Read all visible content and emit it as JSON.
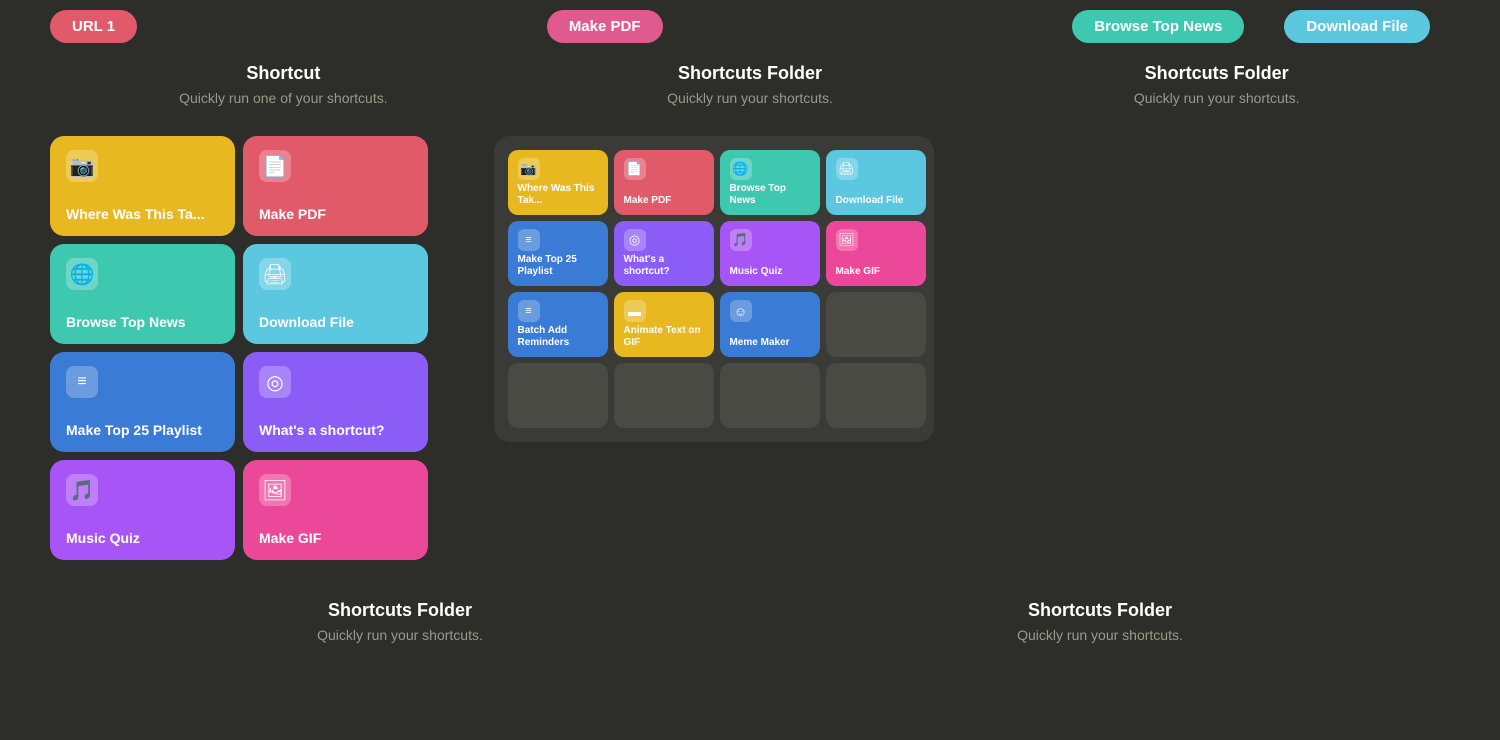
{
  "topPills": [
    {
      "label": "URL 1",
      "color": "pill-red"
    },
    {
      "label": "Make PDF",
      "color": "pill-pink"
    },
    {
      "label": "Browse Top News",
      "color": "pill-teal"
    },
    {
      "label": "Download File",
      "color": "pill-blue"
    }
  ],
  "sections": {
    "left": {
      "title": "Shortcut",
      "subtitle": "Quickly run one of your shortcuts."
    },
    "middle": {
      "title": "Shortcuts Folder",
      "subtitle": "Quickly run your shortcuts."
    },
    "right": {
      "title": "Shortcuts Folder",
      "subtitle": "Quickly run your shortcuts."
    }
  },
  "largeCards": [
    {
      "label": "Where Was This Ta...",
      "color": "card-yellow",
      "icon": "📷"
    },
    {
      "label": "Make PDF",
      "color": "card-red",
      "icon": "📄"
    },
    {
      "label": "Browse Top News",
      "color": "card-teal",
      "icon": "🌐"
    },
    {
      "label": "Download File",
      "color": "card-blue-light",
      "icon": "🖨"
    },
    {
      "label": "Make Top 25 Playlist",
      "color": "card-blue",
      "icon": "≡"
    },
    {
      "label": "What's a shortcut?",
      "color": "card-purple",
      "icon": "◎"
    },
    {
      "label": "Music Quiz",
      "color": "card-purple-light",
      "icon": "♪"
    },
    {
      "label": "Make GIF",
      "color": "card-pink-hot",
      "icon": "🖼"
    }
  ],
  "smallCards": [
    {
      "label": "Where Was This Tak...",
      "color": "card-yellow",
      "icon": "📷"
    },
    {
      "label": "Make PDF",
      "color": "card-red",
      "icon": "📄"
    },
    {
      "label": "Browse Top News",
      "color": "card-teal",
      "icon": "🌐"
    },
    {
      "label": "Download File",
      "color": "card-blue-light",
      "icon": "🖨"
    },
    {
      "label": "Make Top 25 Playlist",
      "color": "card-blue",
      "icon": "≡"
    },
    {
      "label": "What's a shortcut?",
      "color": "card-purple",
      "icon": "◎"
    },
    {
      "label": "Music Quiz",
      "color": "card-purple-light",
      "icon": "♪"
    },
    {
      "label": "Make GIF",
      "color": "card-pink-hot",
      "icon": "🖼"
    },
    {
      "label": "Batch Add Reminders",
      "color": "card-blue",
      "icon": "≡"
    },
    {
      "label": "Animate Text on GIF",
      "color": "card-yellow",
      "icon": "▬"
    },
    {
      "label": "Meme Maker",
      "color": "card-blue",
      "icon": "☺"
    },
    {
      "label": "",
      "color": "",
      "icon": "",
      "empty": true
    },
    {
      "label": "",
      "color": "",
      "icon": "",
      "empty": true
    },
    {
      "label": "",
      "color": "",
      "icon": "",
      "empty": true
    },
    {
      "label": "",
      "color": "",
      "icon": "",
      "empty": true
    },
    {
      "label": "",
      "color": "",
      "icon": "",
      "empty": true
    }
  ],
  "bottomSections": [
    {
      "title": "Shortcuts Folder",
      "subtitle": "Quickly run your shortcuts."
    },
    {
      "title": "Shortcuts Folder",
      "subtitle": "Quickly run your shortcuts."
    }
  ]
}
